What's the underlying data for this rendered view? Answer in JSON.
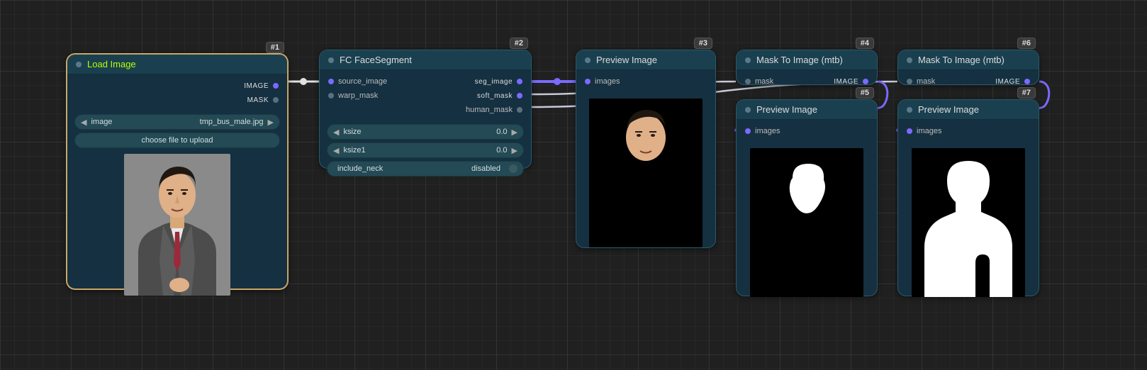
{
  "nodes": {
    "n1": {
      "badge": "#1",
      "title": "Load Image",
      "outputs": {
        "image": "IMAGE",
        "mask": "MASK"
      },
      "widgets": {
        "image_label": "image",
        "image_value": "tmp_bus_male.jpg",
        "upload_label": "choose file to upload"
      }
    },
    "n2": {
      "badge": "#2",
      "title": "FC FaceSegment",
      "inputs": {
        "source_image": "source_image",
        "warp_mask": "warp_mask"
      },
      "outputs": {
        "seg_image": "seg_image",
        "soft_mask": "soft_mask",
        "human_mask": "human_mask"
      },
      "widgets": {
        "ksize_label": "ksize",
        "ksize_value": "0.0",
        "ksize1_label": "ksize1",
        "ksize1_value": "0.0",
        "include_neck_label": "include_neck",
        "include_neck_value": "disabled"
      }
    },
    "n3": {
      "badge": "#3",
      "title": "Preview Image",
      "inputs": {
        "images": "images"
      }
    },
    "n4": {
      "badge": "#4",
      "title": "Mask To Image (mtb)",
      "inputs": {
        "mask": "mask"
      },
      "outputs": {
        "image": "IMAGE"
      }
    },
    "n5": {
      "badge": "#5",
      "title": "Preview Image",
      "inputs": {
        "images": "images"
      }
    },
    "n6": {
      "badge": "#6",
      "title": "Mask To Image (mtb)",
      "inputs": {
        "mask": "mask"
      },
      "outputs": {
        "image": "IMAGE"
      }
    },
    "n7": {
      "badge": "#7",
      "title": "Preview Image",
      "inputs": {
        "images": "images"
      }
    }
  },
  "links": [
    {
      "from": "n1.IMAGE",
      "to": "n2.source_image"
    },
    {
      "from": "n2.seg_image",
      "to": "n3.images"
    },
    {
      "from": "n2.soft_mask",
      "to": "n4.mask"
    },
    {
      "from": "n2.human_mask",
      "to": "n6.mask"
    },
    {
      "from": "n4.IMAGE",
      "to": "n5.images"
    },
    {
      "from": "n6.IMAGE",
      "to": "n7.images"
    }
  ]
}
